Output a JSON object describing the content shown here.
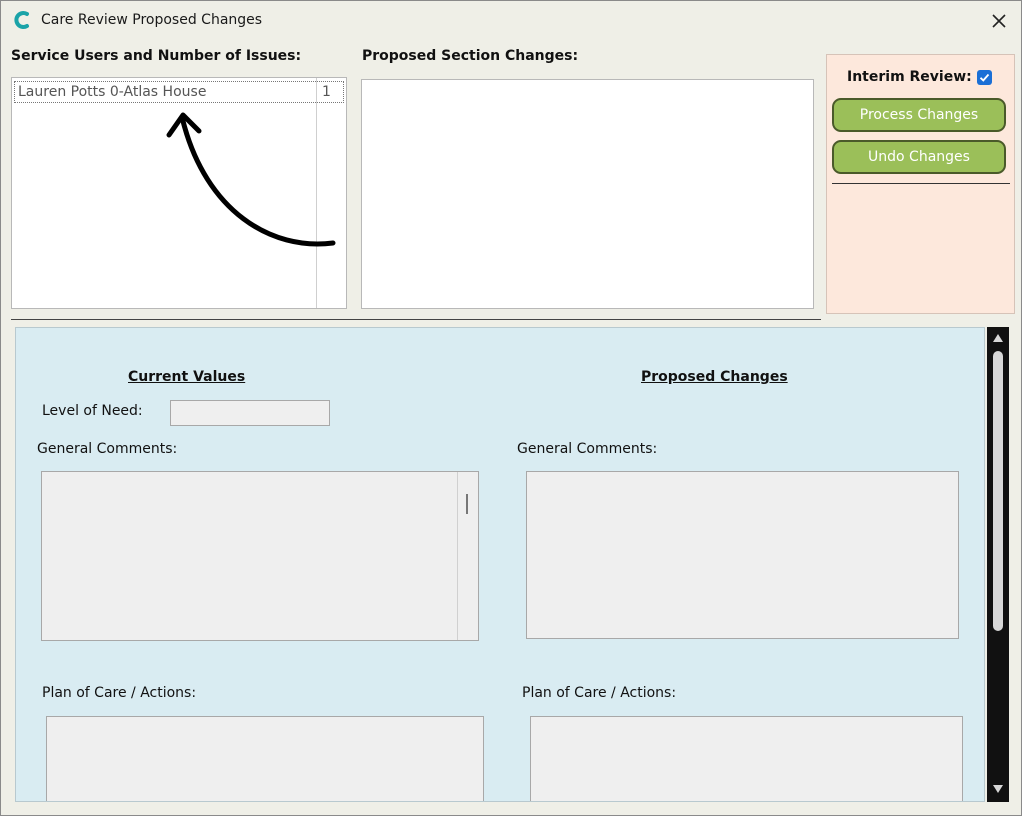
{
  "window": {
    "title": "Care Review Proposed Changes"
  },
  "service_users": {
    "label": "Service Users and Number of Issues:",
    "rows": [
      {
        "name": "Lauren Potts 0-Atlas House",
        "count": "1"
      }
    ]
  },
  "proposed_section": {
    "label": "Proposed Section Changes:"
  },
  "actions": {
    "interim_review_label": "Interim Review:",
    "interim_review_checked": true,
    "process_label": "Process Changes",
    "undo_label": "Undo Changes",
    "button_color": "#9bbf59",
    "panel_color": "#fde8dc"
  },
  "details": {
    "current_heading": "Current Values",
    "proposed_heading": "Proposed Changes",
    "level_of_need_label": "Level of Need:",
    "current_general_label": "General Comments:",
    "proposed_general_label": "General Comments:",
    "current_plan_label": "Plan of Care / Actions:",
    "proposed_plan_label": "Plan of Care / Actions:",
    "panel_color": "#d9ecf2"
  }
}
